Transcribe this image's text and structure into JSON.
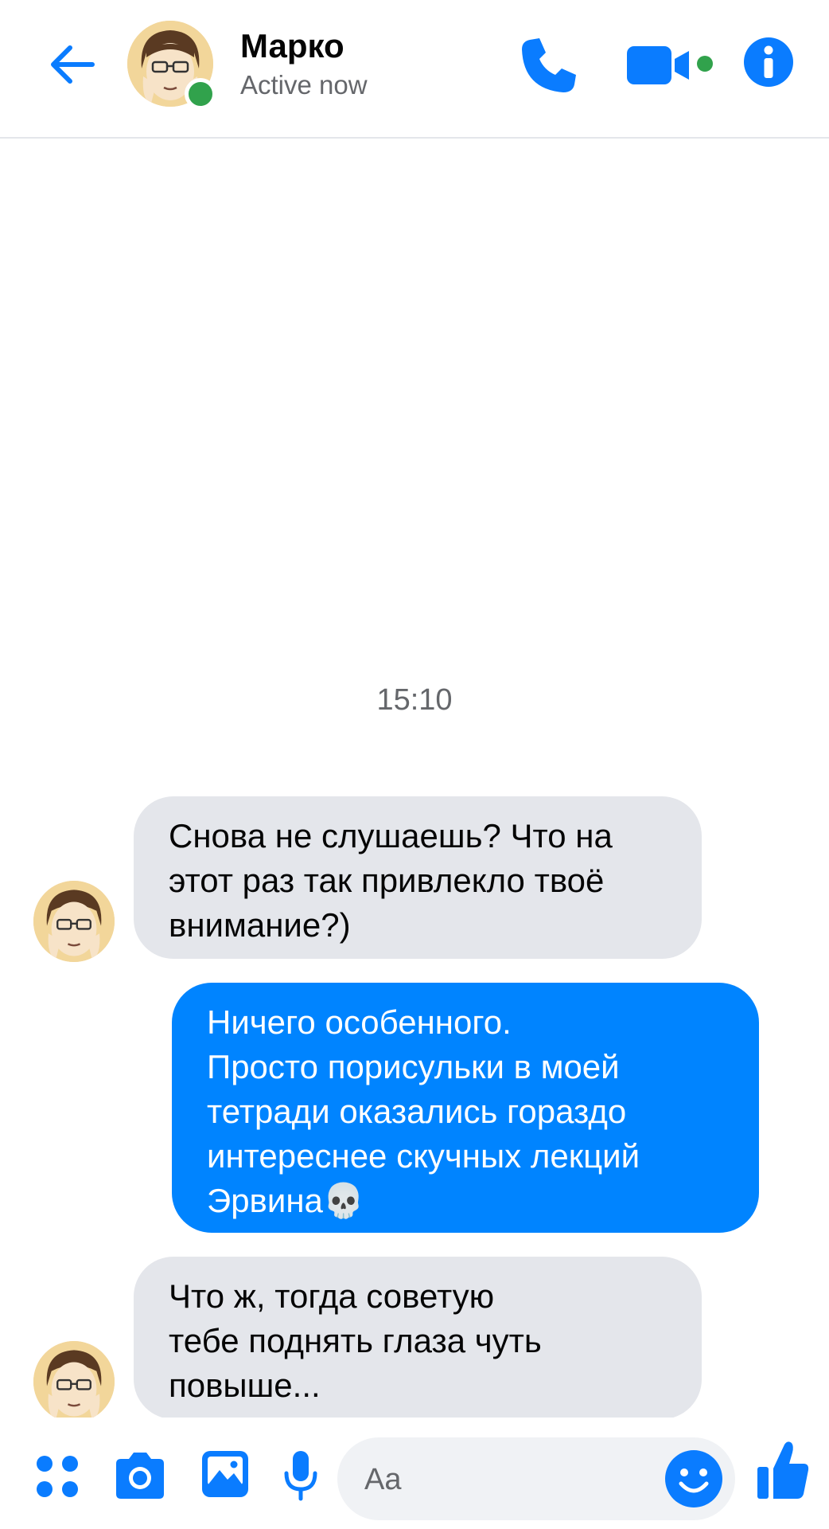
{
  "header": {
    "contact_name": "Марко",
    "status": "Active now",
    "presence_color": "#31a24c",
    "icons": [
      "back-arrow-icon",
      "phone-icon",
      "video-camera-icon",
      "info-icon"
    ]
  },
  "conversation": {
    "timestamp": "15:10",
    "messages": [
      {
        "direction": "incoming",
        "text": "Снова не слушаешь? Что на\nэтот раз так привлекло твоё\nвнимание?)"
      },
      {
        "direction": "outgoing",
        "text": "Ничего особенного.\nПросто порисульки в моей\nтетради оказались гораздо\nинтереснее скучных лекций\nЭрвина💀"
      },
      {
        "direction": "incoming",
        "text": "Что ж, тогда советую\nтебе поднять глаза чуть\nповыше..."
      }
    ]
  },
  "composer": {
    "placeholder": "Aa",
    "icons": [
      "apps-icon",
      "camera-icon",
      "gallery-icon",
      "microphone-icon",
      "emoji-icon",
      "like-icon"
    ]
  },
  "colors": {
    "accent": "#0084ff",
    "incoming_bubble": "#e4e6eb",
    "outgoing_bubble": "#0084ff"
  }
}
